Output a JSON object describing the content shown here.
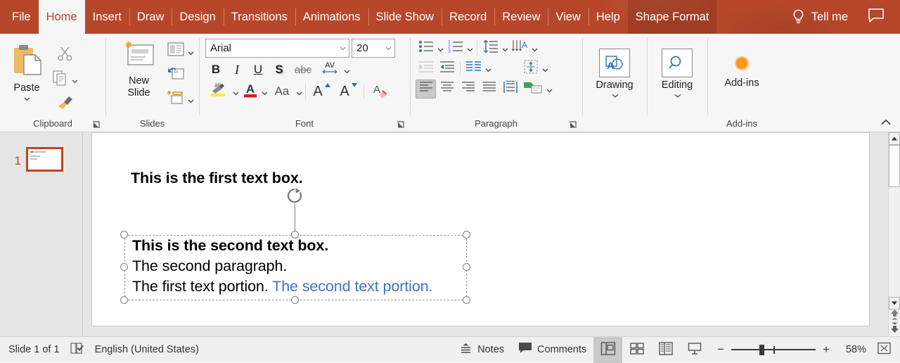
{
  "tabs": [
    {
      "label": "File",
      "state": "normal"
    },
    {
      "label": "Home",
      "state": "active"
    },
    {
      "label": "Insert",
      "state": "normal"
    },
    {
      "label": "Draw",
      "state": "normal"
    },
    {
      "label": "Design",
      "state": "normal"
    },
    {
      "label": "Transitions",
      "state": "normal"
    },
    {
      "label": "Animations",
      "state": "normal"
    },
    {
      "label": "Slide Show",
      "state": "normal"
    },
    {
      "label": "Record",
      "state": "normal"
    },
    {
      "label": "Review",
      "state": "normal"
    },
    {
      "label": "View",
      "state": "normal"
    },
    {
      "label": "Help",
      "state": "normal"
    },
    {
      "label": "Shape Format",
      "state": "contextual"
    }
  ],
  "titlebar": {
    "tell_me": "Tell me",
    "tell_me_icon": "lightbulb-icon",
    "comments_icon": "comment-balloon-icon",
    "accent_color": "#b7472a"
  },
  "ribbon": {
    "collapse_icon": "chevron-up-icon",
    "groups": [
      {
        "name": "clipboard",
        "label": "Clipboard",
        "paste_label": "Paste",
        "has_dialog_launcher": true,
        "items": [
          {
            "name": "paste-button",
            "icon": "clipboard-icon"
          },
          {
            "name": "cut-button",
            "icon": "scissors-icon"
          },
          {
            "name": "copy-button",
            "icon": "copy-icon"
          },
          {
            "name": "format-painter-button",
            "icon": "paintbrush-icon"
          }
        ]
      },
      {
        "name": "slides",
        "label": "Slides",
        "new_slide_label": "New Slide",
        "has_dialog_launcher": false,
        "items": [
          {
            "name": "new-slide-button",
            "icon": "new-slide-icon"
          },
          {
            "name": "layout-button",
            "icon": "layout-icon"
          },
          {
            "name": "reset-button",
            "icon": "reset-icon"
          },
          {
            "name": "section-button",
            "icon": "section-icon"
          }
        ]
      },
      {
        "name": "font",
        "label": "Font",
        "has_dialog_launcher": true,
        "font_name": "Arial",
        "font_size": "20",
        "items": [
          {
            "name": "bold-button",
            "icon": "bold-icon",
            "glyph": "B"
          },
          {
            "name": "italic-button",
            "icon": "italic-icon",
            "glyph": "I"
          },
          {
            "name": "underline-button",
            "icon": "underline-icon",
            "glyph": "U"
          },
          {
            "name": "text-shadow-button",
            "icon": "text-shadow-icon",
            "glyph": "S"
          },
          {
            "name": "strikethrough-button",
            "icon": "strikethrough-icon",
            "glyph": "abc"
          },
          {
            "name": "character-spacing-button",
            "icon": "character-spacing-icon",
            "glyph": "AV"
          },
          {
            "name": "text-highlight-button",
            "icon": "highlighter-icon"
          },
          {
            "name": "font-color-button",
            "icon": "font-color-icon",
            "glyph": "A"
          },
          {
            "name": "change-case-button",
            "icon": "change-case-icon",
            "glyph": "Aa"
          },
          {
            "name": "increase-font-size-button",
            "icon": "increase-font-size-icon"
          },
          {
            "name": "decrease-font-size-button",
            "icon": "decrease-font-size-icon"
          },
          {
            "name": "clear-formatting-button",
            "icon": "clear-formatting-icon"
          }
        ]
      },
      {
        "name": "paragraph",
        "label": "Paragraph",
        "has_dialog_launcher": true,
        "items": [
          {
            "name": "bullets-button",
            "icon": "bullet-list-icon"
          },
          {
            "name": "numbering-button",
            "icon": "numbered-list-icon"
          },
          {
            "name": "line-spacing-button",
            "icon": "line-spacing-icon"
          },
          {
            "name": "text-direction-button",
            "icon": "text-direction-icon"
          },
          {
            "name": "decrease-indent-button",
            "icon": "decrease-indent-icon"
          },
          {
            "name": "increase-indent-button",
            "icon": "increase-indent-icon"
          },
          {
            "name": "columns-button",
            "icon": "columns-icon"
          },
          {
            "name": "align-text-button",
            "icon": "align-text-vertical-icon"
          },
          {
            "name": "align-left-button",
            "icon": "align-left-icon",
            "selected": true
          },
          {
            "name": "align-center-button",
            "icon": "align-center-icon"
          },
          {
            "name": "align-right-button",
            "icon": "align-right-icon"
          },
          {
            "name": "justify-button",
            "icon": "justify-icon"
          },
          {
            "name": "distributed-button",
            "icon": "distributed-icon"
          },
          {
            "name": "convert-to-smartart-button",
            "icon": "smartart-icon"
          }
        ]
      },
      {
        "name": "drawing",
        "label": "",
        "caption": "Drawing",
        "icon": "drawing-shapes-icon"
      },
      {
        "name": "editing",
        "label": "",
        "caption": "Editing",
        "icon": "magnifier-icon"
      },
      {
        "name": "addins",
        "label": "Add-ins",
        "caption": "Add-ins",
        "icon": "addins-dot-icon"
      }
    ]
  },
  "thumbnails": {
    "slides": [
      {
        "number": "1",
        "selected": true
      }
    ]
  },
  "slide": {
    "textbox1": {
      "text": "This is the first text box.",
      "selected": false
    },
    "textbox2": {
      "selected": true,
      "lines": [
        {
          "runs": [
            {
              "text": "This is the second text box.",
              "bold": true,
              "color": "#000000"
            }
          ]
        },
        {
          "runs": [
            {
              "text": "The second paragraph.",
              "bold": false,
              "color": "#000000"
            }
          ]
        },
        {
          "runs": [
            {
              "text": "The first text portion. ",
              "bold": false,
              "color": "#000000"
            },
            {
              "text": "The second text portion.",
              "bold": false,
              "color": "#4472c4"
            }
          ]
        }
      ]
    }
  },
  "scrollbar": {
    "up_icon": "triangle-up-icon",
    "down_icon": "triangle-down-icon",
    "prev_slide_icon": "double-arrow-up-icon",
    "next_slide_icon": "double-arrow-down-icon"
  },
  "statusbar": {
    "slide_count": "Slide 1 of 1",
    "accessibility_icon": "accessibility-checker-icon",
    "language": "English (United States)",
    "notes_label": "Notes",
    "notes_icon": "notes-icon",
    "comments_label": "Comments",
    "comments_icon": "comment-icon",
    "views": [
      {
        "name": "normal-view-button",
        "icon": "normal-view-icon",
        "selected": true
      },
      {
        "name": "slide-sorter-button",
        "icon": "slide-sorter-icon",
        "selected": false
      },
      {
        "name": "reading-view-button",
        "icon": "reading-view-icon",
        "selected": false
      },
      {
        "name": "slide-show-button",
        "icon": "slide-show-icon",
        "selected": false
      }
    ],
    "zoom_out_label": "−",
    "zoom_in_label": "+",
    "zoom_level": "58%",
    "fit_icon": "fit-to-window-icon"
  }
}
